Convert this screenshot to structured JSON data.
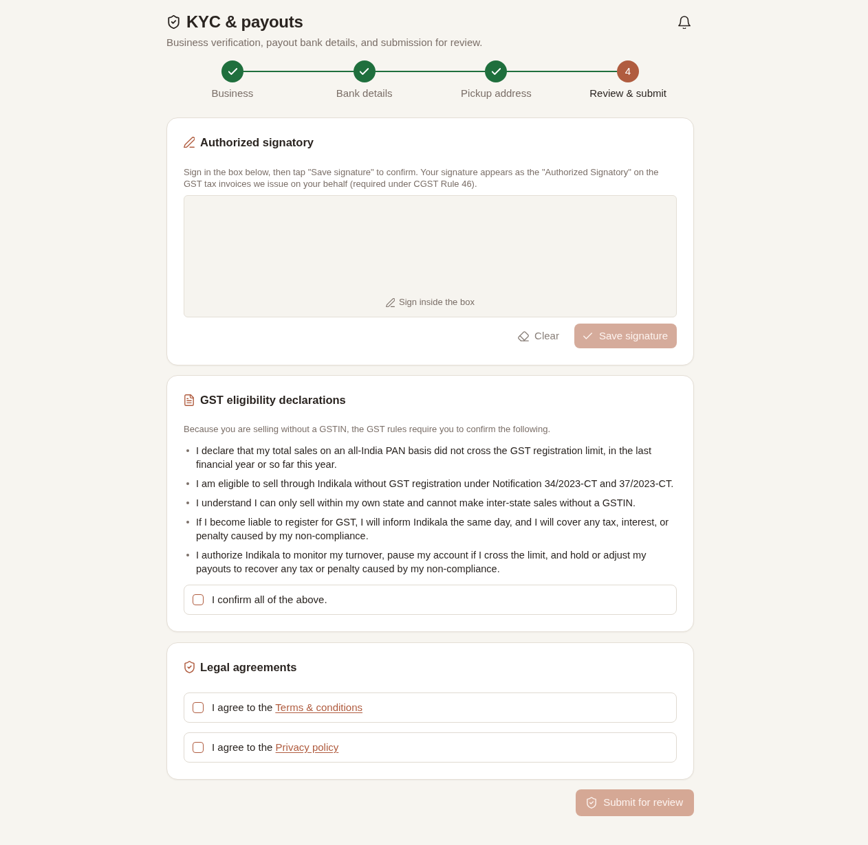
{
  "header": {
    "title": "KYC & payouts",
    "subtitle": "Business verification, payout bank details, and submission for review."
  },
  "stepper": [
    {
      "label": "Business",
      "completed": true,
      "current": false
    },
    {
      "label": "Bank details",
      "completed": true,
      "current": false
    },
    {
      "label": "Pickup address",
      "completed": true,
      "current": false
    },
    {
      "label": "Review & submit",
      "completed": false,
      "current": true,
      "number": "4"
    }
  ],
  "signature_card": {
    "title": "Authorized signatory",
    "description": "Sign in the box below, then tap \"Save signature\" to confirm. Your signature appears as the \"Authorized Signatory\" on the GST tax invoices we issue on your behalf (required under CGST Rule 46).",
    "pad": {
      "placeholder": "Sign inside the box"
    },
    "clear_button": {
      "label": "Clear"
    },
    "save_button": {
      "label": "Save signature",
      "disabled": true
    }
  },
  "declarations_card": {
    "title": "GST eligibility declarations",
    "intro": "Because you are selling without a GSTIN, the GST rules require you to confirm the following.",
    "items": [
      "I declare that my total sales on an all-India PAN basis did not cross the GST registration limit, in the last financial year or so far this year.",
      "I am eligible to sell through Indikala without GST registration under Notification 34/2023-CT and 37/2023-CT.",
      "I understand I can only sell within my own state and cannot make inter-state sales without a GSTIN.",
      "If I become liable to register for GST, I will inform Indikala the same day, and I will cover any tax, interest, or penalty caused by my non-compliance.",
      "I authorize Indikala to monitor my turnover, pause my account if I cross the limit, and hold or adjust my payouts to recover any tax or penalty caused by my non-compliance."
    ],
    "confirm": {
      "label": "I confirm all of the above.",
      "checked": false
    }
  },
  "legal_card": {
    "title": "Legal agreements",
    "agreements": [
      {
        "text": "I agree to the",
        "link": "Terms & conditions",
        "checked": false
      },
      {
        "text": "I agree to the",
        "link": "Privacy policy",
        "checked": false
      }
    ]
  },
  "submit_button": {
    "label": "Submit for review",
    "disabled": true
  }
}
